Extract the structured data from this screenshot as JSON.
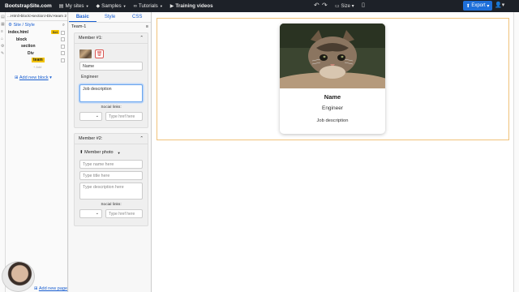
{
  "topbar": {
    "brand": "BootstrapSite.com",
    "nav": [
      {
        "icon": "sites-icon",
        "label": "My sites"
      },
      {
        "icon": "samples-icon",
        "label": "Samples"
      },
      {
        "icon": "tutorials-icon",
        "label": "Tutorials"
      },
      {
        "icon": "video-icon",
        "label": "Training videos"
      }
    ],
    "size_label": "Size",
    "export_label": "Export"
  },
  "tree": {
    "breadcrumb": "...Html>block>section>Div>team",
    "breadcrumb_end": "2",
    "site_label": "Site / Style",
    "rows": [
      {
        "label": "index.html",
        "badge": "Set"
      },
      {
        "label": "block"
      },
      {
        "label": "section"
      },
      {
        "label": "Div"
      },
      {
        "label": "team",
        "selected": true
      },
      {
        "label": "+ Add"
      }
    ],
    "add_block": "Add new block"
  },
  "props": {
    "tabs": [
      "Basic",
      "Style",
      "CSS"
    ],
    "team_title": "Team-1",
    "member1": {
      "header": "Member #1:",
      "name_value": "Name",
      "title_value": "Engineer",
      "desc_value": "Job description",
      "social_label": "Social links:",
      "href_placeholder": "Type href here"
    },
    "member2": {
      "header": "Member #2:",
      "photo_button": "Member photo",
      "name_placeholder": "Type name here",
      "title_placeholder": "Type title here",
      "desc_placeholder": "Type description here",
      "social_label": "Social links:",
      "href_placeholder": "Type href here"
    }
  },
  "canvas": {
    "card": {
      "name": "Name",
      "title": "Engineer",
      "description": "Job description"
    }
  },
  "footer": {
    "add_page": "Add new page"
  },
  "colors": {
    "topbar": "#1d2128",
    "export": "#1e6fd9",
    "selected": "#f2c200",
    "block_border": "#f0c27a"
  }
}
